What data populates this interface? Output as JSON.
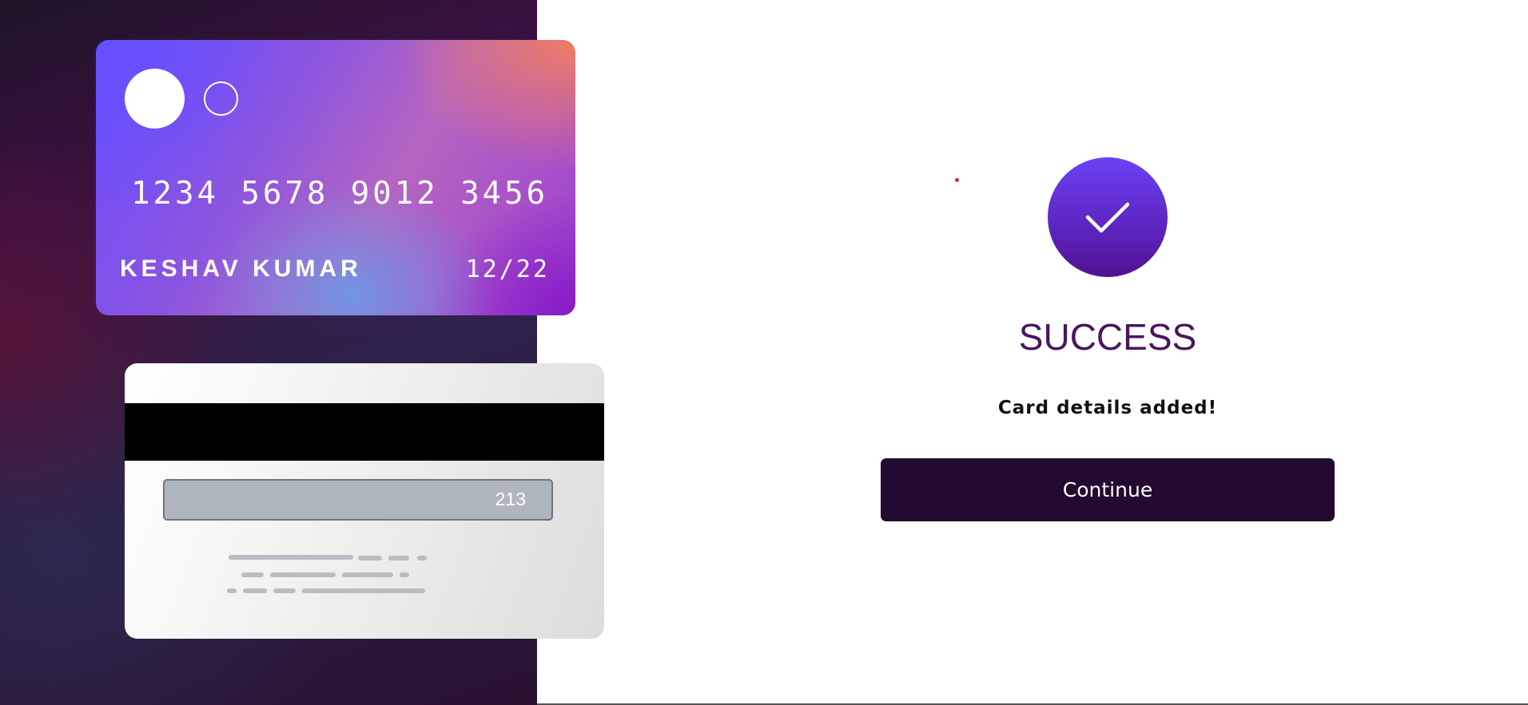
{
  "card_front": {
    "number": "1234 5678 9012 3456",
    "holder_name": "KESHAV KUMAR",
    "expiry": "12/22"
  },
  "card_back": {
    "cvv": "213"
  },
  "success": {
    "icon": "check-icon",
    "title": "SUCCESS",
    "message": "Card details added!",
    "continue_label": "Continue"
  },
  "colors": {
    "left_panel_bg": "#2d1a3c",
    "success_circle_top": "#6a42f5",
    "success_circle_bottom": "#52108f",
    "title_color": "#4a155f",
    "button_bg": "#220a30",
    "button_text": "#ffffff"
  }
}
